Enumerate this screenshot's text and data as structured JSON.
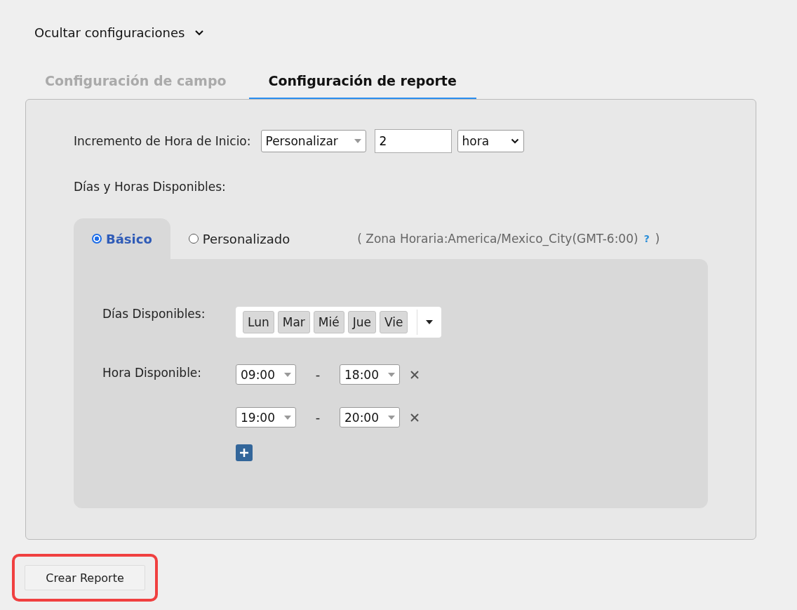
{
  "toggle": {
    "label": "Ocultar configuraciones",
    "expanded": true
  },
  "tabs": [
    {
      "label": "Configuración de campo",
      "selected": false
    },
    {
      "label": "Configuración de reporte",
      "selected": true
    }
  ],
  "increment": {
    "label": "Incremento de Hora de Inicio:",
    "mode": "Personalizar",
    "value": "2",
    "unit": "hora"
  },
  "availability": {
    "label": "Días y Horas Disponibles:",
    "modes": [
      {
        "label": "Básico",
        "selected": true
      },
      {
        "label": "Personalizado",
        "selected": false
      }
    ],
    "timezone": "( Zona Horaria:America/Mexico_City(GMT-6:00)",
    "help": "?",
    "timezone_close": ")",
    "days_label": "Días Disponibles:",
    "days": [
      "Lun",
      "Mar",
      "Mié",
      "Jue",
      "Vie"
    ],
    "hours_label": "Hora Disponible:",
    "ranges": [
      {
        "start": "09:00",
        "separator": "-",
        "end": "18:00"
      },
      {
        "start": "19:00",
        "separator": "-",
        "end": "20:00"
      }
    ]
  },
  "create_button": {
    "label": "Crear Reporte",
    "highlighted": true
  }
}
